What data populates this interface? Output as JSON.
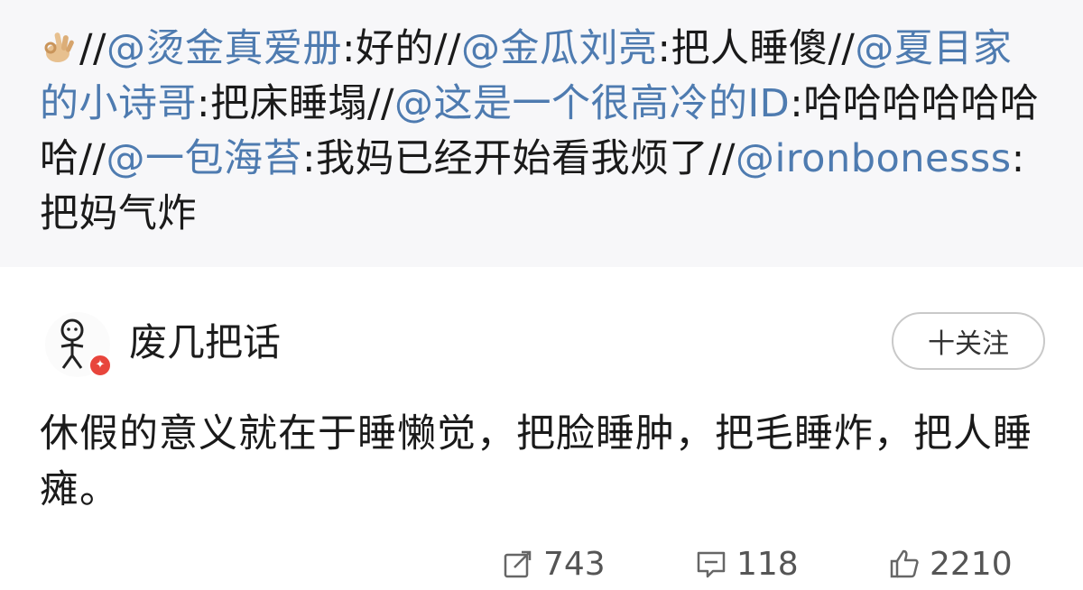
{
  "repost": {
    "emoji": "ok-hand-emoji",
    "segments": [
      {
        "type": "text",
        "value": "//"
      },
      {
        "type": "mention",
        "value": "@烫金真爱册"
      },
      {
        "type": "text",
        "value": ":好的//"
      },
      {
        "type": "mention",
        "value": "@金瓜刘亮"
      },
      {
        "type": "text",
        "value": ":把人睡傻//"
      },
      {
        "type": "mention",
        "value": "@夏目家的小诗哥"
      },
      {
        "type": "text",
        "value": ":把床睡塌//"
      },
      {
        "type": "mention",
        "value": "@这是一个很高冷的ID"
      },
      {
        "type": "text",
        "value": ":哈哈哈哈哈哈哈//"
      },
      {
        "type": "mention",
        "value": "@一包海苔"
      },
      {
        "type": "text",
        "value": ":我妈已经开始看我烦了//"
      },
      {
        "type": "mention",
        "value": "@ironbonesss"
      },
      {
        "type": "text",
        "value": ":把妈气炸"
      }
    ]
  },
  "post": {
    "username": "废几把话",
    "follow_label": "十关注",
    "content": "休假的意义就在于睡懒觉，把脸睡肿，把毛睡炸，把人睡瘫。",
    "avatar_icon": "stick-figure-icon",
    "badge_icon": "verified-badge-icon"
  },
  "actions": {
    "repost_count": "743",
    "comment_count": "118",
    "like_count": "2210"
  },
  "colors": {
    "mention": "#4e7bb0",
    "badge": "#e8453c",
    "background_top": "#f7f7f9",
    "card": "#ffffff"
  }
}
